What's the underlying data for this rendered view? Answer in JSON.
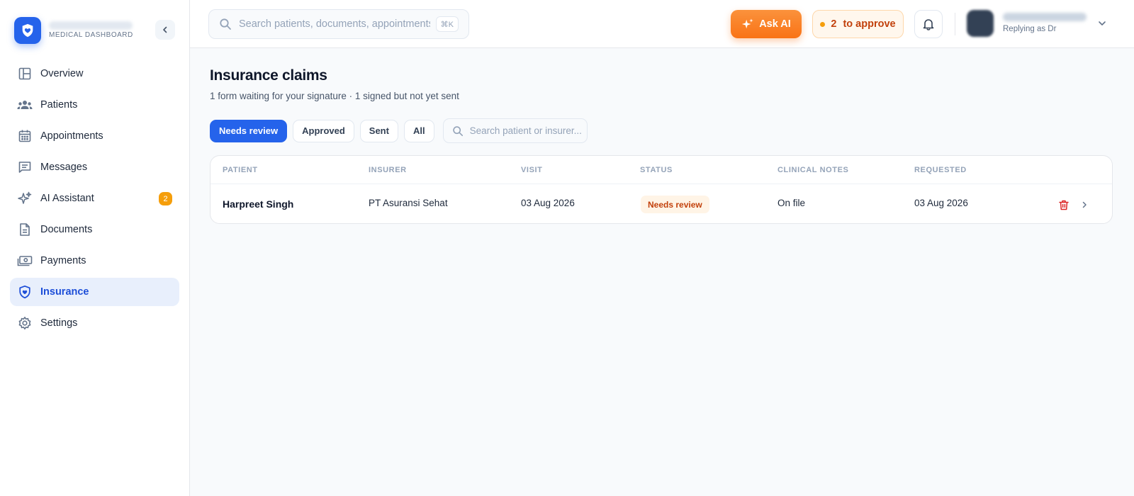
{
  "sidebar": {
    "brand_subtitle": "MEDICAL DASHBOARD",
    "items": [
      {
        "label": "Overview",
        "icon": "layout-icon"
      },
      {
        "label": "Patients",
        "icon": "users-icon"
      },
      {
        "label": "Appointments",
        "icon": "calendar-icon"
      },
      {
        "label": "Messages",
        "icon": "message-icon"
      },
      {
        "label": "AI Assistant",
        "icon": "sparkles-icon",
        "badge": "2"
      },
      {
        "label": "Documents",
        "icon": "document-icon"
      },
      {
        "label": "Payments",
        "icon": "cash-icon"
      },
      {
        "label": "Insurance",
        "icon": "shield-heart-icon",
        "active": true
      },
      {
        "label": "Settings",
        "icon": "gear-icon"
      }
    ]
  },
  "header": {
    "search_placeholder": "Search patients, documents, appointments",
    "search_shortcut": "⌘K",
    "ask_ai_label": "Ask AI",
    "approve_count": "2",
    "approve_label": "to approve",
    "user_role": "Replying as Dr"
  },
  "page": {
    "title": "Insurance claims",
    "subtitle": "1 form waiting for your signature · 1 signed but not yet sent"
  },
  "filters": {
    "tabs": [
      "Needs review",
      "Approved",
      "Sent",
      "All"
    ],
    "active": "Needs review",
    "search_placeholder": "Search patient or insurer..."
  },
  "table": {
    "columns": [
      "PATIENT",
      "INSURER",
      "VISIT",
      "STATUS",
      "CLINICAL NOTES",
      "REQUESTED"
    ],
    "rows": [
      {
        "patient": "Harpreet Singh",
        "insurer": "PT Asuransi Sehat",
        "visit": "03 Aug 2026",
        "status": "Needs review",
        "clinical_notes": "On file",
        "requested": "03 Aug 2026"
      }
    ]
  },
  "colors": {
    "primary": "#2563eb",
    "accent_orange": "#f97316",
    "warning": "#f59e0b",
    "danger": "#dc2626"
  }
}
